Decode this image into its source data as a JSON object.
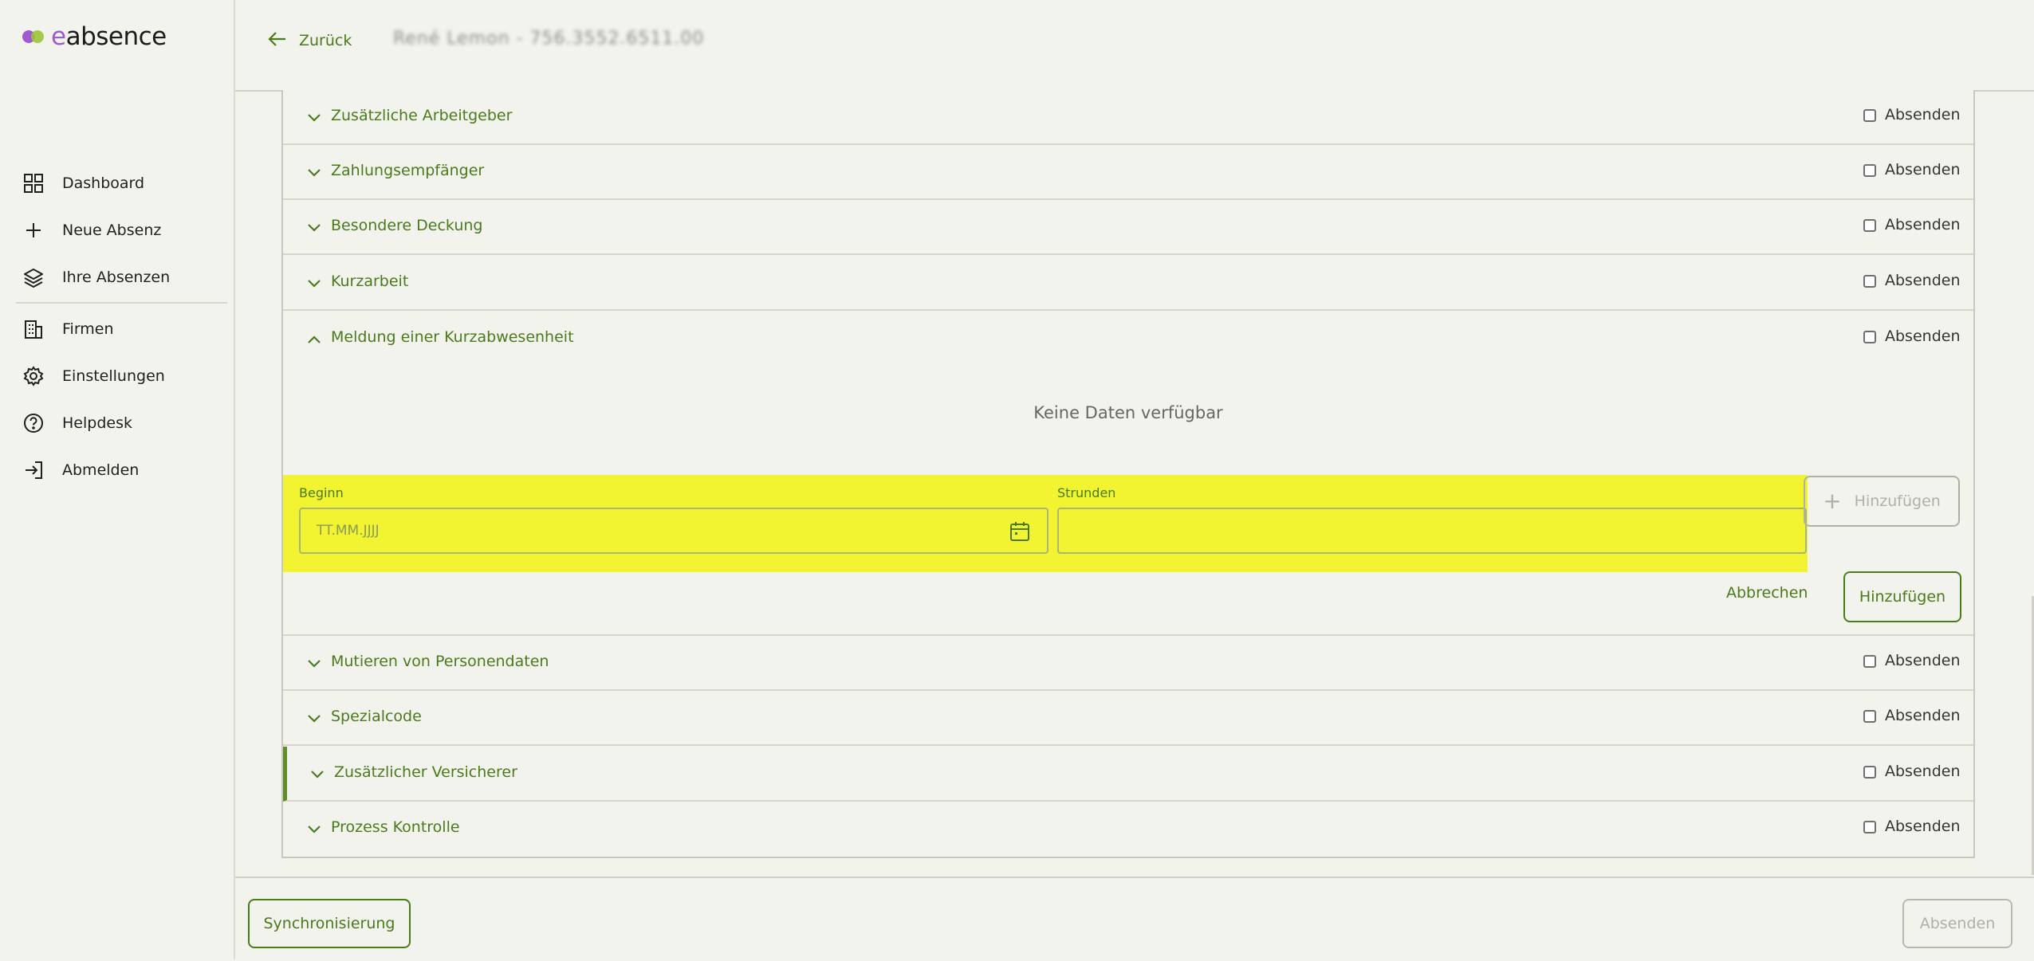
{
  "app": {
    "logo_prefix": "e",
    "logo_rest": "absence",
    "colors": {
      "accent": "#4b7a1c",
      "highlight": "#f2f331",
      "logo_purple": "#a05ad0",
      "logo_green": "#9bc43a"
    }
  },
  "sidebar": {
    "items": [
      {
        "label": "Dashboard",
        "icon": "grid-icon"
      },
      {
        "label": "Neue Absenz",
        "icon": "plus-icon"
      },
      {
        "label": "Ihre Absenzen",
        "icon": "layers-icon"
      },
      {
        "label": "Firmen",
        "icon": "building-icon"
      },
      {
        "label": "Einstellungen",
        "icon": "gear-icon"
      },
      {
        "label": "Helpdesk",
        "icon": "help-circle-icon"
      },
      {
        "label": "Abmelden",
        "icon": "logout-icon"
      }
    ]
  },
  "header": {
    "back_label": "Zurück",
    "person": "René Lemon - 756.3552.6511.00"
  },
  "sections": [
    {
      "title": "Zusätzliche Arbeitgeber",
      "send_label": "Absenden",
      "expanded": false
    },
    {
      "title": "Zahlungsempfänger",
      "send_label": "Absenden",
      "expanded": false
    },
    {
      "title": "Besondere Deckung",
      "send_label": "Absenden",
      "expanded": false
    },
    {
      "title": "Kurzarbeit",
      "send_label": "Absenden",
      "expanded": false
    },
    {
      "title": "Meldung einer Kurzabwesenheit",
      "send_label": "Absenden",
      "expanded": true
    },
    {
      "title": "Mutieren von Personendaten",
      "send_label": "Absenden",
      "expanded": false
    },
    {
      "title": "Spezialcode",
      "send_label": "Absenden",
      "expanded": false
    },
    {
      "title": "Zusätzlicher Versicherer",
      "send_label": "Absenden",
      "expanded": false
    },
    {
      "title": "Prozess Kontrolle",
      "send_label": "Absenden",
      "expanded": false
    }
  ],
  "kurzabwesenheit": {
    "empty_text": "Keine Daten verfügbar",
    "begin_label": "Beginn",
    "begin_placeholder": "TT.MM.JJJJ",
    "hours_label": "Strunden",
    "add_ghost_label": "Hinzufügen",
    "cancel_label": "Abbrechen",
    "add_label": "Hinzufügen"
  },
  "footer": {
    "sync_label": "Synchronisierung",
    "send_label": "Absenden"
  }
}
